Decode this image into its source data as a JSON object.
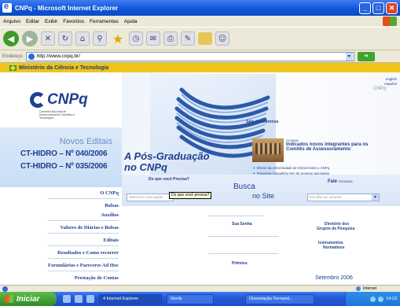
{
  "window": {
    "title": "CNPq - Microsoft Internet Explorer",
    "controls": [
      "minimize-icon",
      "maximize-icon",
      "close-icon"
    ]
  },
  "menu": [
    "Arquivo",
    "Editar",
    "Exibir",
    "Favoritos",
    "Ferramentas",
    "Ajuda"
  ],
  "toolbar": {
    "icons": [
      "back-icon",
      "forward-icon",
      "stop-icon",
      "refresh-icon",
      "home-icon",
      "search-icon",
      "favorites-icon",
      "history-icon",
      "mail-icon",
      "print-icon",
      "edit-icon",
      "folder-icon",
      "messenger-icon"
    ]
  },
  "address": {
    "label": "Endereço",
    "url": "http://www.cnpq.br/",
    "go_label": "Ir"
  },
  "site": {
    "gov_bar": "Ministério da Ciência e Tecnologia",
    "logo_text": "CNPq",
    "logo_sub": "Conselho Nacional de Desenvolvimento Científico e Tecnológico",
    "lang": [
      "english",
      "español"
    ],
    "cnpq_header": "CNPq",
    "novos_editais": "Novos Editais",
    "edital_1": "CT-HIDRO – Nº 040/2006",
    "edital_2": "CT-HIDRO – Nº 035/2006",
    "hero_line1": "A Pós-Graduação",
    "hero_line2": "no CNPq",
    "sala": "Sala de Imprensa",
    "ind_date": "21/09/06",
    "ind_title": "Indicados novos integrantes para os Comitês de Assessoramento",
    "news": [
      "Diretor da Universidade de Oxford visita o CNPq",
      "Programa Casadinho tem 82 projetos aprovados",
      "Presidente do CNPq recebe homenagem da UFLA"
    ],
    "nav": [
      "O CNPq",
      "Bolsas",
      "Auxílios",
      "Valores de Diárias e Bolsas",
      "Editais",
      "Resultados e Como recorrer",
      "Formulários e Pareceres Ad Hoc",
      "Prestação de Contas"
    ],
    "question_title": "Do que você Precisa?",
    "question_placeholder": "Selecione uma opção",
    "tooltip": "Do que você precisa?",
    "busca": "Busca",
    "no_site": "no Site",
    "fale": "Fale",
    "fale_sub": "Conosco",
    "select_placeholder": "Escolha um assunto",
    "links": {
      "sua_senha": "Sua Senha",
      "premios": "Prêmios",
      "diretorio_1": "Diretório dos",
      "diretorio_2": "Grupos de Pesquisa",
      "instrumentos_1": "Instrumentos",
      "instrumentos_2": "Normativos",
      "setembro": "Setembro 2006"
    }
  },
  "status": {
    "zone": "Internet"
  },
  "taskbar": {
    "start": "Iniciar",
    "tasks": [
      "4 Internet Explorer",
      "Nerds",
      "Dissertação Fernand..."
    ],
    "clock": "14:23"
  },
  "colors": {
    "title_blue": "#0d54d6",
    "brand_blue": "#1f3f8f",
    "gov_yellow": "#f0c419",
    "start_green": "#318c27"
  }
}
